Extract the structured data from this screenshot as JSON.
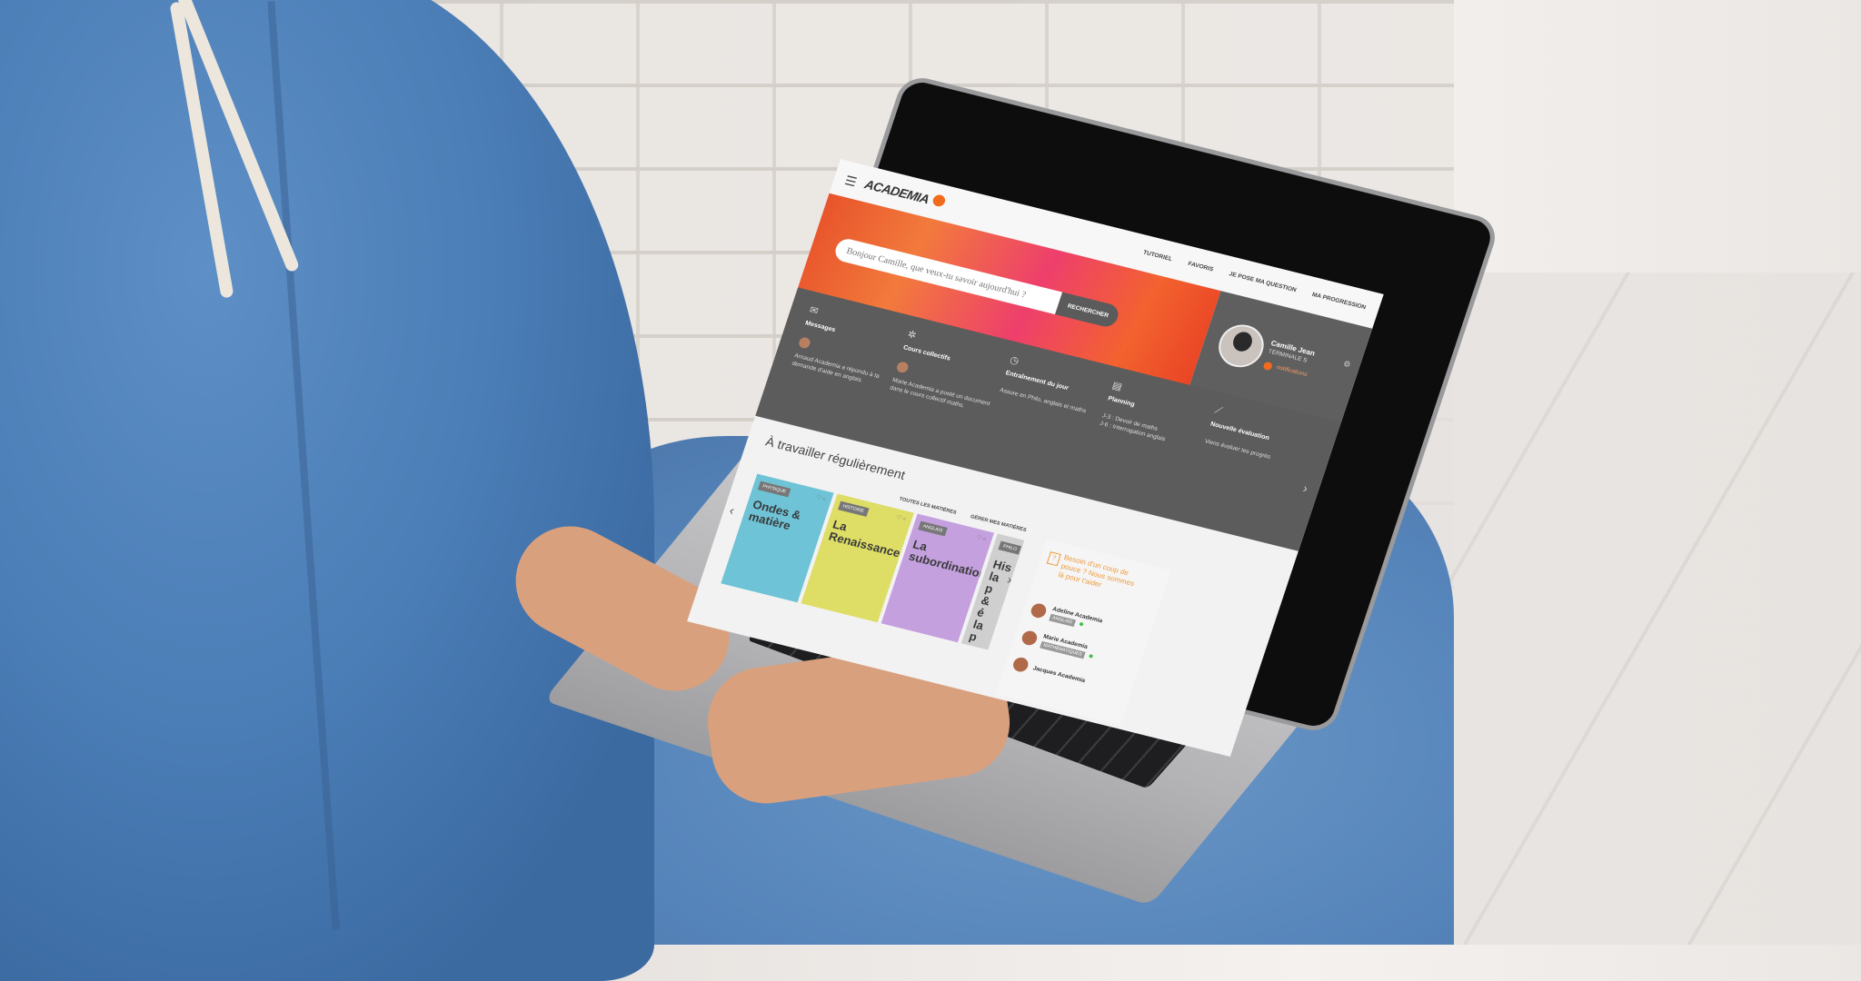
{
  "app": {
    "logo_text": "ACADEMIA",
    "menu_icon": "hamburger-icon"
  },
  "nav": {
    "items": [
      "TUTORIEL",
      "FAVORIS",
      "JE POSE MA QUESTION",
      "MA PROGRESSION"
    ]
  },
  "search": {
    "placeholder": "Bonjour Camille, que veux-tu savoir aujourd'hui ?",
    "button_label": "RECHERCHER"
  },
  "profile": {
    "name": "Camille Jean",
    "class": "TERMINALE S",
    "notifications_label": "notifications"
  },
  "dashboard": {
    "widgets": [
      {
        "icon": "message-icon",
        "title": "Messages",
        "text": "Arnaud Academia a répondu à ta demande d'aide en anglais."
      },
      {
        "icon": "group-icon",
        "title": "Cours collectifs",
        "text": "Marie Academia a posté un document dans le cours collectif maths."
      },
      {
        "icon": "clock-icon",
        "title": "Entraînement du jour",
        "text": "Assure en Philo, anglais et maths"
      },
      {
        "icon": "calendar-icon",
        "title": "Planning",
        "text": "J-3 : Devoir de maths",
        "text2": "J-6 : Interrogation anglais"
      },
      {
        "icon": "chart-icon",
        "title": "Nouvelle évaluation",
        "text": "Viens évaluer tes progrès"
      }
    ]
  },
  "courses": {
    "section_title": "À travailler régulièrement",
    "link_all": "TOUTES LES MATIÈRES",
    "link_manage": "GÉRER MES MATIÈRES",
    "cards": [
      {
        "tag": "PHYSIQUE",
        "title": "Ondes & matière",
        "color": "#6ec3d6"
      },
      {
        "tag": "HISTOIRE",
        "title": "La Renaissance",
        "color": "#dedd66"
      },
      {
        "tag": "ANGLAIS",
        "title": "La subordination",
        "color": "#c4a0df"
      },
      {
        "tag": "PHILO",
        "title": "His la p & é la p",
        "color": "#cfcfcf"
      }
    ]
  },
  "help": {
    "text": "Besoin d'un coup de pouce ? Nous sommes là pour t'aider",
    "tutors": [
      {
        "name": "Adeline Academia",
        "subject": "ANGLAIS"
      },
      {
        "name": "Marie Academia",
        "subject": "MATHÉMATIQUES"
      },
      {
        "name": "Jacques Academia",
        "subject": ""
      }
    ]
  },
  "colors": {
    "brand_orange": "#f26b1d",
    "dashboard_gray": "#5c5c5c"
  }
}
